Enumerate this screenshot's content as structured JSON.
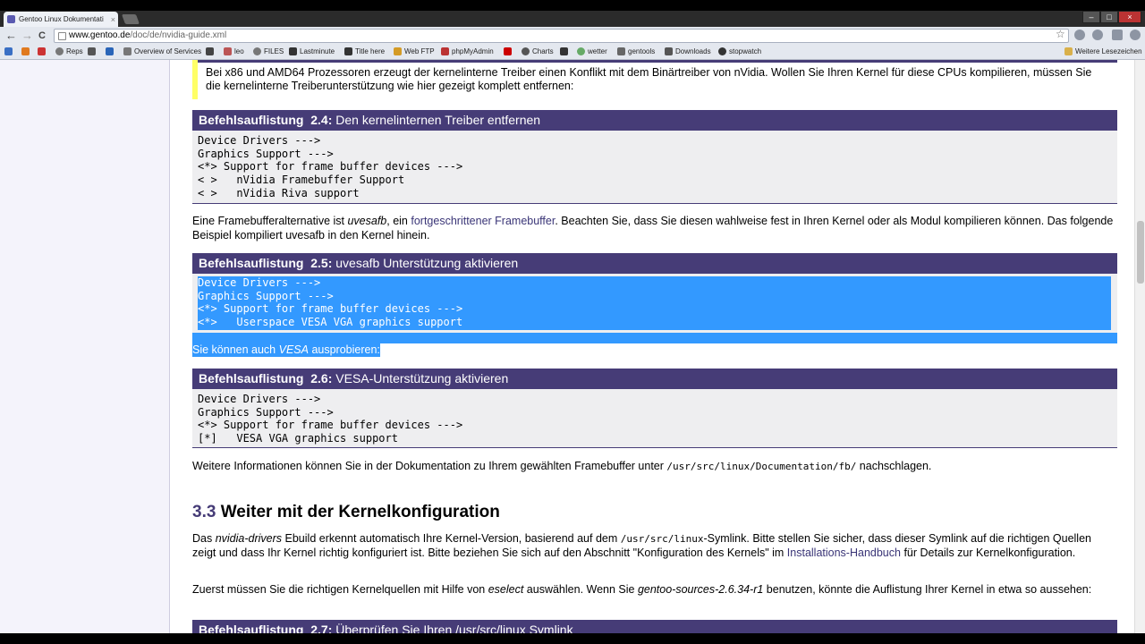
{
  "browser": {
    "tab_title": "Gentoo Linux Dokumentati",
    "tab_close": "×",
    "url_host": "www.gentoo.de",
    "url_path": "/doc/de/nvidia-guide.xml",
    "nav": {
      "back": "←",
      "forward": "→",
      "reload": "C"
    },
    "star": "☆",
    "window_controls": [
      "–",
      "□",
      "×"
    ]
  },
  "bookmarks": {
    "items": [
      {
        "label": "",
        "color": "#3a6fc4"
      },
      {
        "label": "",
        "color": "#e07a1f"
      },
      {
        "label": "",
        "color": "#c33"
      },
      {
        "label": "Reps",
        "color": "#777"
      },
      {
        "label": "",
        "color": "#555"
      },
      {
        "label": "",
        "color": "#2a65b8"
      },
      {
        "label": "Overview of Services",
        "color": "#777"
      },
      {
        "label": "",
        "color": "#444"
      },
      {
        "label": "leo",
        "color": "#b55"
      },
      {
        "label": "FILES",
        "color": "#777"
      },
      {
        "label": "Lastminute",
        "color": "#333"
      },
      {
        "label": "Title here",
        "color": "#333"
      },
      {
        "label": "Web FTP",
        "color": "#d49b26"
      },
      {
        "label": "phpMyAdmin",
        "color": "#b33"
      },
      {
        "label": "",
        "color": "#c00"
      },
      {
        "label": "Charts",
        "color": "#555"
      },
      {
        "label": "",
        "color": "#333"
      },
      {
        "label": "wetter",
        "color": "#6a6"
      },
      {
        "label": "gentools",
        "color": "#666"
      },
      {
        "label": "Downloads",
        "color": "#555"
      },
      {
        "label": "stopwatch",
        "color": "#333"
      }
    ],
    "other_bookmarks": "Weitere Lesezeichen"
  },
  "page": {
    "note_text": "Bei x86 und AMD64 Prozessoren erzeugt der kernelinterne Treiber einen Konflikt mit dem Binärtreiber von nVidia. Wollen Sie Ihren Kernel für diese CPUs kompilieren, müssen Sie die kernelinterne Treiberunterstützung wie hier gezeigt komplett entfernen:",
    "listing_24": {
      "label": "Befehlsauflistung",
      "num": "2.4:",
      "title": "Den kernelinternen Treiber entfernen",
      "lines": [
        "Device Drivers --->",
        "Graphics Support --->",
        "<*> Support for frame buffer devices --->",
        "< >   nVidia Framebuffer Support",
        "< >   nVidia Riva support"
      ]
    },
    "para_fb": {
      "p1": "Eine Framebufferalternative ist ",
      "em1": "uvesafb",
      "p2": ", ein ",
      "link": "fortgeschrittener Framebuffer",
      "p3": ". Beachten Sie, dass Sie diesen wahlweise fest in Ihren Kernel oder als Modul kompilieren können. Das folgende Beispiel kompiliert uvesafb in den Kernel hinein."
    },
    "listing_25": {
      "label": "Befehlsauflistung",
      "num": "2.5:",
      "title": "uvesafb Unterstützung aktivieren",
      "lines": [
        "Device Drivers --->",
        "Graphics Support --->",
        "<*> Support for frame buffer devices --->",
        "<*>   Userspace VESA VGA graphics support"
      ]
    },
    "para_vesa": {
      "p1": "Sie können auch ",
      "em1": "VESA",
      "p2": " ausprobieren:"
    },
    "listing_26": {
      "label": "Befehlsauflistung",
      "num": "2.6:",
      "title": "VESA-Unterstützung aktivieren",
      "lines": [
        "Device Drivers --->",
        "Graphics Support --->",
        "<*> Support for frame buffer devices --->",
        "[*]   VESA VGA graphics support"
      ]
    },
    "para_docs": {
      "p1": "Weitere Informationen können Sie in der Dokumentation zu Ihrem gewählten Framebuffer unter ",
      "code": "/usr/src/linux/Documentation/fb/",
      "p2": " nachschlagen."
    },
    "section_33": {
      "num": "3.3",
      "title": "Weiter mit der Kernelkonfiguration"
    },
    "para_detect": {
      "p1": "Das ",
      "em1": "nvidia-drivers",
      "p2": " Ebuild erkennt automatisch Ihre Kernel-Version, basierend auf dem ",
      "code": "/usr/src/linux",
      "p3": "-Symlink. Bitte stellen Sie sicher, dass dieser Symlink auf die richtigen Quellen zeigt und dass Ihr Kernel richtig konfiguriert ist. Bitte beziehen Sie sich auf den Abschnitt \"Konfiguration des Kernels\" im ",
      "link": "Installations-Handbuch",
      "p4": " für Details zur Kernelkonfiguration."
    },
    "para_eselect": {
      "p1": "Zuerst müssen Sie die richtigen Kernelquellen mit Hilfe von ",
      "em1": "eselect",
      "p2": " auswählen. Wenn Sie ",
      "em2": "gentoo-sources-2.6.34-r1",
      "p3": " benutzen, könnte die Auflistung Ihrer Kernel in etwa so aussehen:"
    },
    "listing_27": {
      "label": "Befehlsauflistung",
      "num": "2.7:",
      "title": "Überprüfen Sie Ihren /usr/src/linux Symlink"
    }
  }
}
